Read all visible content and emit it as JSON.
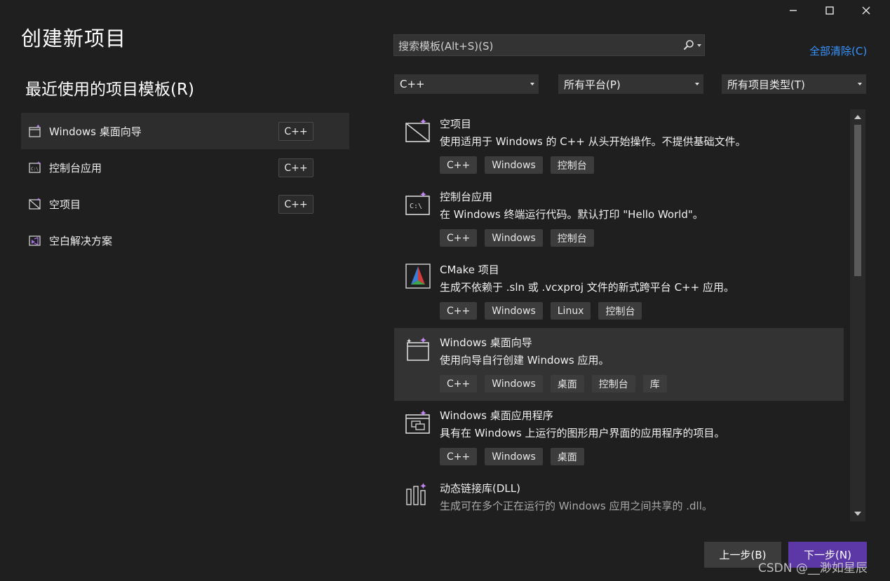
{
  "page": {
    "title": "创建新项目",
    "recent_title": "最近使用的项目模板(R)"
  },
  "window_controls": [
    "minimize",
    "maximize",
    "close"
  ],
  "recent": [
    {
      "label": "Windows 桌面向导",
      "lang": "C++",
      "icon": "windows-desktop-wizard-icon",
      "selected": true
    },
    {
      "label": "控制台应用",
      "lang": "C++",
      "icon": "console-app-icon"
    },
    {
      "label": "空项目",
      "lang": "C++",
      "icon": "empty-project-icon"
    },
    {
      "label": "空白解决方案",
      "lang": "",
      "icon": "blank-solution-icon"
    }
  ],
  "search": {
    "placeholder": "搜索模板(Alt+S)(S)",
    "clear_all": "全部清除(C)"
  },
  "filters": {
    "language": "C++",
    "platform": "所有平台(P)",
    "project_type": "所有项目类型(T)"
  },
  "results": [
    {
      "title": "空项目",
      "desc": "使用适用于 Windows 的 C++ 从头开始操作。不提供基础文件。",
      "tags": [
        "C++",
        "Windows",
        "控制台"
      ],
      "icon": "empty-project-icon"
    },
    {
      "title": "控制台应用",
      "desc": "在 Windows 终端运行代码。默认打印 \"Hello World\"。",
      "tags": [
        "C++",
        "Windows",
        "控制台"
      ],
      "icon": "console-app-icon"
    },
    {
      "title": "CMake 项目",
      "desc": "生成不依赖于 .sln 或 .vcxproj 文件的新式跨平台 C++ 应用。",
      "tags": [
        "C++",
        "Windows",
        "Linux",
        "控制台"
      ],
      "icon": "cmake-icon"
    },
    {
      "title": "Windows 桌面向导",
      "desc": "使用向导自行创建 Windows 应用。",
      "tags": [
        "C++",
        "Windows",
        "桌面",
        "控制台",
        "库"
      ],
      "icon": "windows-desktop-wizard-icon",
      "selected": true
    },
    {
      "title": "Windows 桌面应用程序",
      "desc": "具有在 Windows 上运行的图形用户界面的应用程序的项目。",
      "tags": [
        "C++",
        "Windows",
        "桌面"
      ],
      "icon": "windows-desktop-app-icon"
    },
    {
      "title": "动态链接库(DLL)",
      "desc": "生成可在多个正在运行的 Windows 应用之间共享的 .dll。",
      "tags": [],
      "icon": "dll-icon"
    }
  ],
  "buttons": {
    "back": "上一步(B)",
    "next": "下一步(N)"
  },
  "watermark": "CSDN @__渺如星辰",
  "colors": {
    "accent": "#5b38a6",
    "link": "#3794ff",
    "background": "#1f1f1f"
  }
}
